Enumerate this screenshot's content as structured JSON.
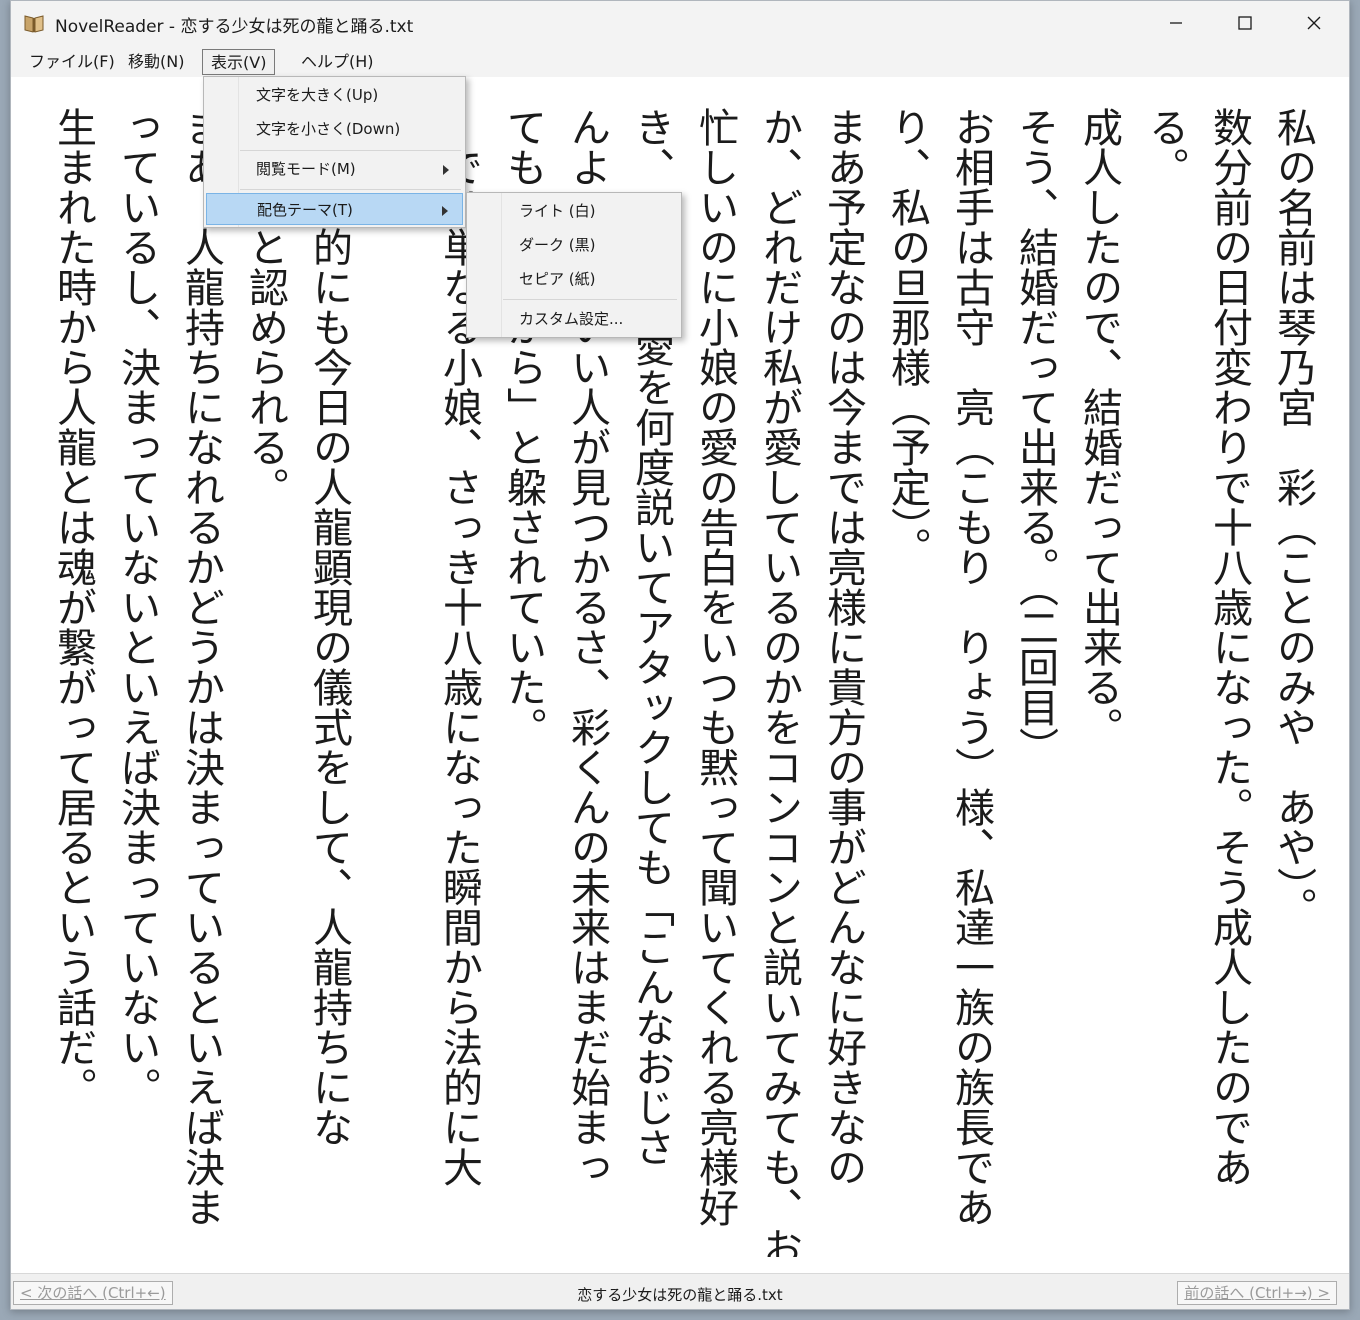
{
  "window": {
    "title": "NovelReader - 恋する少女は死の龍と踊る.txt",
    "icon": "book-icon"
  },
  "menubar": {
    "items": [
      {
        "label": "ファイル(F)"
      },
      {
        "label": "移動(N)"
      },
      {
        "label": "表示(V)"
      },
      {
        "label": "ヘルプ(H)"
      }
    ]
  },
  "view_menu": {
    "items": [
      {
        "label": "文字を大きく(Up)"
      },
      {
        "label": "文字を小さく(Down)"
      },
      {
        "label": "閲覧モード(M)"
      },
      {
        "label": "配色テーマ(T)"
      }
    ]
  },
  "theme_menu": {
    "items": [
      {
        "label": "ライト (白)"
      },
      {
        "label": "ダーク (黒)"
      },
      {
        "label": "セピア (紙)"
      },
      {
        "label": "カスタム設定..."
      }
    ]
  },
  "novel": {
    "columns": [
      "私の名前は琴乃宮　彩（ことのみや　あや）。",
      "数分前の日付変わりで十八歳になった。そう成人したのであ",
      "る。",
      "成人したので、結婚だって出来る。",
      "そう、結婚だって出来る。（二回目）",
      "お相手は古守　亮（こもり　りょう）様、私達一族の族長であ",
      "り、私の旦那様（予定）。",
      "まあ予定なのは今までは亮様に貴方の事がどんなに好きなの",
      "か、どれだけ私が愛しているのかをコンコンと説いてみても、お",
      "忙しいのに小娘の愛の告白をいつも黙って聞いてくれる亮様好",
      "き、　　て、愛を何度説いてアタックしても「こんなおじさ",
      "んよ　　といい人が見つかるさ、彩くんの未来はまだ始まっ",
      "ても　　だから」と躱されていた。",
      "　では単なる小娘、さっき十八歳になった瞬間から法的に大",
      "て一族的にも今日の人龍顕現の儀式をして、人龍持ちにな",
      "一人前と認められる。",
      "まあ、人龍持ちになれるかどうかは決まっているといえば決ま",
      "っているし、決まっていないといえば決まっていない。",
      "生まれた時から人龍とは魂が繋がって居るという話だ。"
    ]
  },
  "status": {
    "prev_button": "< 次の話へ (Ctrl+←)",
    "title": "恋する少女は死の龍と踊る.txt",
    "next_button": "前の話へ (Ctrl+→) >"
  }
}
